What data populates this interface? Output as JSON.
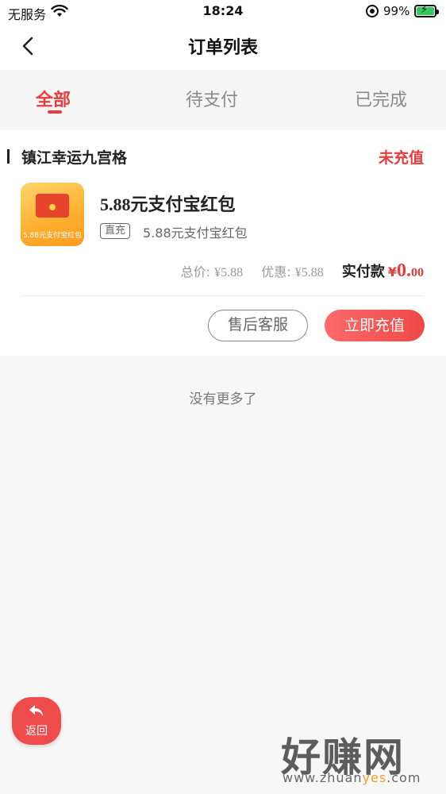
{
  "status_bar": {
    "carrier": "无服务",
    "time": "18:24",
    "battery_percent": "99%"
  },
  "nav": {
    "title": "订单列表"
  },
  "tabs": [
    {
      "label": "全部",
      "active": true
    },
    {
      "label": "待支付",
      "active": false
    },
    {
      "label": "已完成",
      "active": false
    }
  ],
  "order": {
    "shop_name": "镇江幸运九宫格",
    "status": "未充值",
    "product": {
      "title": "5.88元支付宝红包",
      "tag": "直充",
      "subtitle": "5.88元支付宝红包",
      "image_text": "5.88元支付宝红包"
    },
    "price": {
      "total_label": "总价:",
      "total_value": "¥5.88",
      "discount_label": "优惠:",
      "discount_value": "¥5.88",
      "paid_label": "实付款",
      "currency": "¥",
      "paid_int": "0.",
      "paid_dec": "00"
    },
    "buttons": {
      "service": "售后客服",
      "recharge": "立即充值"
    }
  },
  "footer_text": "没有更多了",
  "float_back": {
    "label": "返回"
  },
  "watermark": {
    "main": "好赚网",
    "sub_prefix": "www.zhuan",
    "sub_highlight": "yes",
    "sub_suffix": ".com"
  },
  "colors": {
    "accent": "#e83c3c",
    "battery": "#34c759"
  }
}
